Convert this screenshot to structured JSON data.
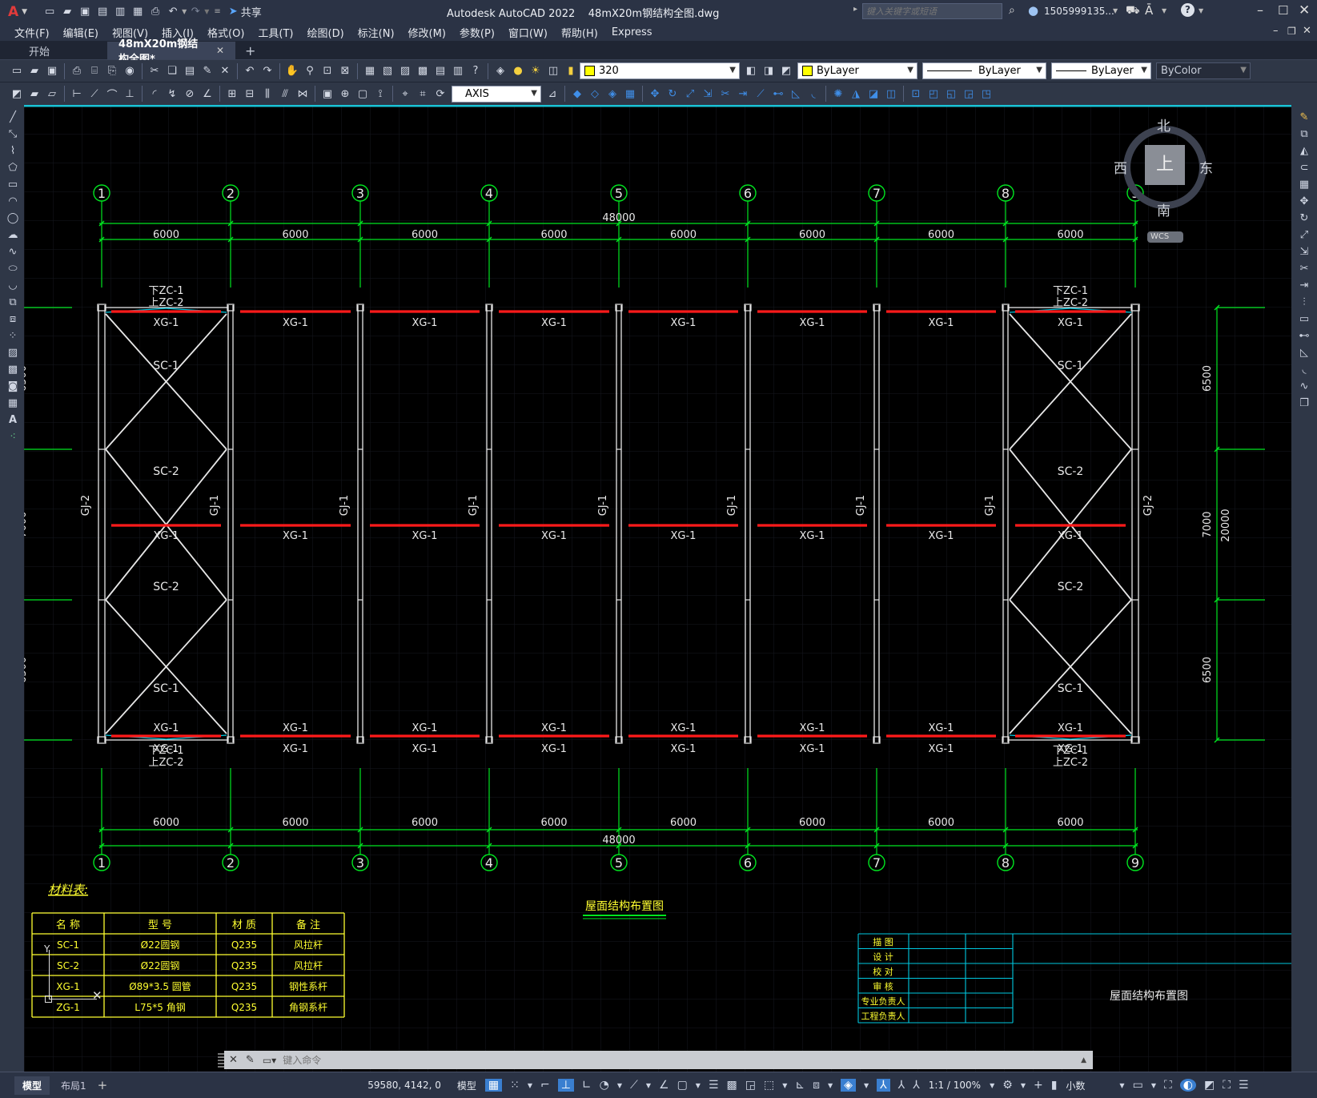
{
  "app": {
    "title": "Autodesk AutoCAD 2022",
    "filename": "48mX20m钢结构全图.dwg",
    "search_placeholder": "键入关键字或短语",
    "user": "1505999135...",
    "share_label": "共享"
  },
  "menu": [
    "文件(F)",
    "编辑(E)",
    "视图(V)",
    "插入(I)",
    "格式(O)",
    "工具(T)",
    "绘图(D)",
    "标注(N)",
    "修改(M)",
    "参数(P)",
    "窗口(W)",
    "帮助(H)",
    "Express"
  ],
  "tabs": [
    {
      "label": "开始",
      "active": false
    },
    {
      "label": "48mX20m钢结构全图*",
      "active": true
    }
  ],
  "toolbar": {
    "layer_value": "320",
    "color_value": "ByLayer",
    "linetype_value": "ByLayer",
    "lineweight_value": "ByLayer",
    "plotstyle_value": "ByColor",
    "dimstyle_value": "AXIS"
  },
  "viewcube": {
    "north": "北",
    "south": "南",
    "east": "东",
    "west": "西",
    "top": "上",
    "wcs": "WCS"
  },
  "drawing": {
    "axis_labels": [
      "1",
      "2",
      "3",
      "4",
      "5",
      "6",
      "7",
      "8",
      "9"
    ],
    "total_dim": "48000",
    "bay_dim": "6000",
    "side_dims": [
      "6500",
      "7000",
      "6500"
    ],
    "side_total": "20000",
    "labels": {
      "xg1": "XG-1",
      "sc1": "SC-1",
      "sc2": "SC-2",
      "gj1": "GJ-1",
      "gj2": "GJ-2",
      "zc1_bottom": "下ZC-1",
      "zc2_top": "上ZC-2"
    },
    "plan_title": "屋面结构布置图",
    "material_title": "材料表:",
    "material_headers": [
      "名 称",
      "型 号",
      "材 质",
      "备 注"
    ],
    "material_rows": [
      [
        "SC-1",
        "Ø22圆钢",
        "Q235",
        "风拉杆"
      ],
      [
        "SC-2",
        "Ø22圆钢",
        "Q235",
        "风拉杆"
      ],
      [
        "XG-1",
        "Ø89*3.5 圆管",
        "Q235",
        "钢性系杆"
      ],
      [
        "ZG-1",
        "L75*5 角钢",
        "Q235",
        "角钢系杆"
      ]
    ],
    "title_block_rows": [
      "描 图",
      "设 计",
      "校 对",
      "审 核",
      "专业负责人",
      "工程负责人"
    ],
    "title_block_name": "屋面结构布置图"
  },
  "command": {
    "placeholder": "键入命令"
  },
  "layout_tabs": [
    "模型",
    "布局1"
  ],
  "status": {
    "coords": "59580, 4142, 0",
    "model_label": "模型",
    "scale": "1:1 / 100%",
    "units": "小数"
  }
}
